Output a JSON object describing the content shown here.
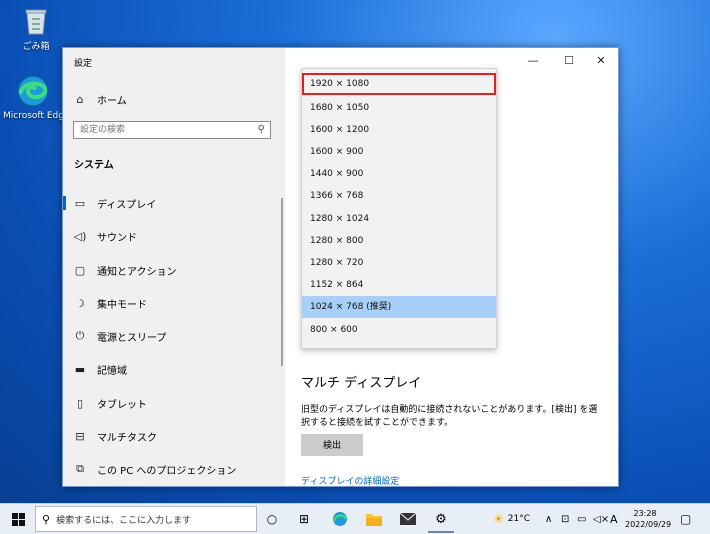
{
  "desktop": {
    "icons": [
      {
        "label": "ごみ箱"
      },
      {
        "label": "Microsoft Edge"
      }
    ]
  },
  "window": {
    "title": "設定",
    "controls": {
      "minimize": "—",
      "maximize": "☐",
      "close": "✕"
    }
  },
  "sidebar": {
    "home": "ホーム",
    "search_placeholder": "設定の検索",
    "section": "システム",
    "items": [
      {
        "label": "ディスプレイ",
        "icon": "monitor-icon"
      },
      {
        "label": "サウンド",
        "icon": "speaker-icon"
      },
      {
        "label": "通知とアクション",
        "icon": "notification-icon"
      },
      {
        "label": "集中モード",
        "icon": "moon-icon"
      },
      {
        "label": "電源とスリープ",
        "icon": "power-icon"
      },
      {
        "label": "記憶域",
        "icon": "storage-icon"
      },
      {
        "label": "タブレット",
        "icon": "tablet-icon"
      },
      {
        "label": "マルチタスク",
        "icon": "multitask-icon"
      },
      {
        "label": "この PC へのプロジェクション",
        "icon": "projection-icon"
      }
    ]
  },
  "resolution_dropdown": {
    "options": [
      "1920 × 1080",
      "1680 × 1050",
      "1600 × 1200",
      "1600 × 900",
      "1440 × 900",
      "1366 × 768",
      "1280 × 1024",
      "1280 × 800",
      "1280 × 720",
      "1152 × 864",
      "1024 × 768 (推奨)",
      "800 × 600"
    ],
    "selected": "1024 × 768 (推奨)",
    "highlighted": "1920 × 1080"
  },
  "main": {
    "multi_display_heading": "マルチ ディスプレイ",
    "description": "旧型のディスプレイは自動的に接続されないことがあります。[検出] を選択すると接続を試すことができます。",
    "detect_button": "検出",
    "advanced_link": "ディスプレイの詳細設定"
  },
  "taskbar": {
    "search_placeholder": "検索するには、ここに入力します",
    "temperature": "21°C",
    "ime": "A",
    "time": "23:28",
    "date": "2022/09/29"
  }
}
